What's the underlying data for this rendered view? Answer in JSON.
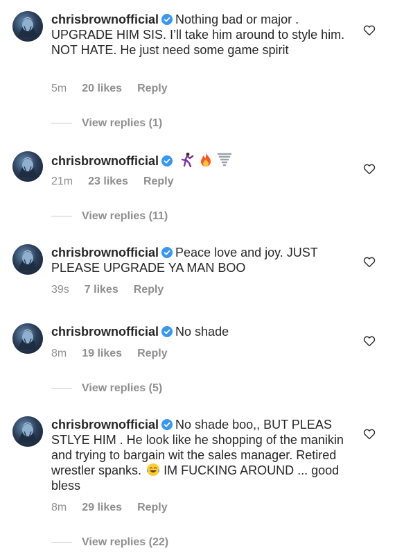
{
  "comments": [
    {
      "username": "chrisbrownofficial",
      "text": "Nothing bad or major . UPGRADE  HIM SIS. I’ll take him around to style him. NOT HATE. He just need some game spirit",
      "time": "5m",
      "likes": "20 likes",
      "reply": "Reply",
      "view_replies": "View replies (1)"
    },
    {
      "username": "chrisbrownofficial",
      "text": "",
      "emojis": [
        "dancer-emoji",
        "fire-emoji",
        "tornado-emoji"
      ],
      "time": "21m",
      "likes": "23 likes",
      "reply": "Reply",
      "view_replies": "View replies (11)"
    },
    {
      "username": "chrisbrownofficial",
      "text": "Peace love and joy. JUST PLEASE UPGRADE YA MAN BOO",
      "time": "39s",
      "likes": "7 likes",
      "reply": "Reply"
    },
    {
      "username": "chrisbrownofficial",
      "text": "No shade",
      "time": "8m",
      "likes": "19 likes",
      "reply": "Reply",
      "view_replies": "View replies (5)"
    },
    {
      "username": "chrisbrownofficial",
      "text_before_emoji": "No shade boo,, BUT PLEAS STLYE HIM . He look like he shopping of the manikin and trying to bargain wit the sales manager. Retired wrestler spanks.",
      "emoji": "laughing-tears-emoji",
      "text_after_emoji": "IM FUCKING AROUND ... good bless",
      "time": "8m",
      "likes": "29 likes",
      "reply": "Reply",
      "view_replies": "View replies (22)"
    }
  ],
  "colors": {
    "text": "#262626",
    "meta": "#8e8e8e",
    "verified": "#3897f0",
    "divider": "#c7c7c7"
  }
}
